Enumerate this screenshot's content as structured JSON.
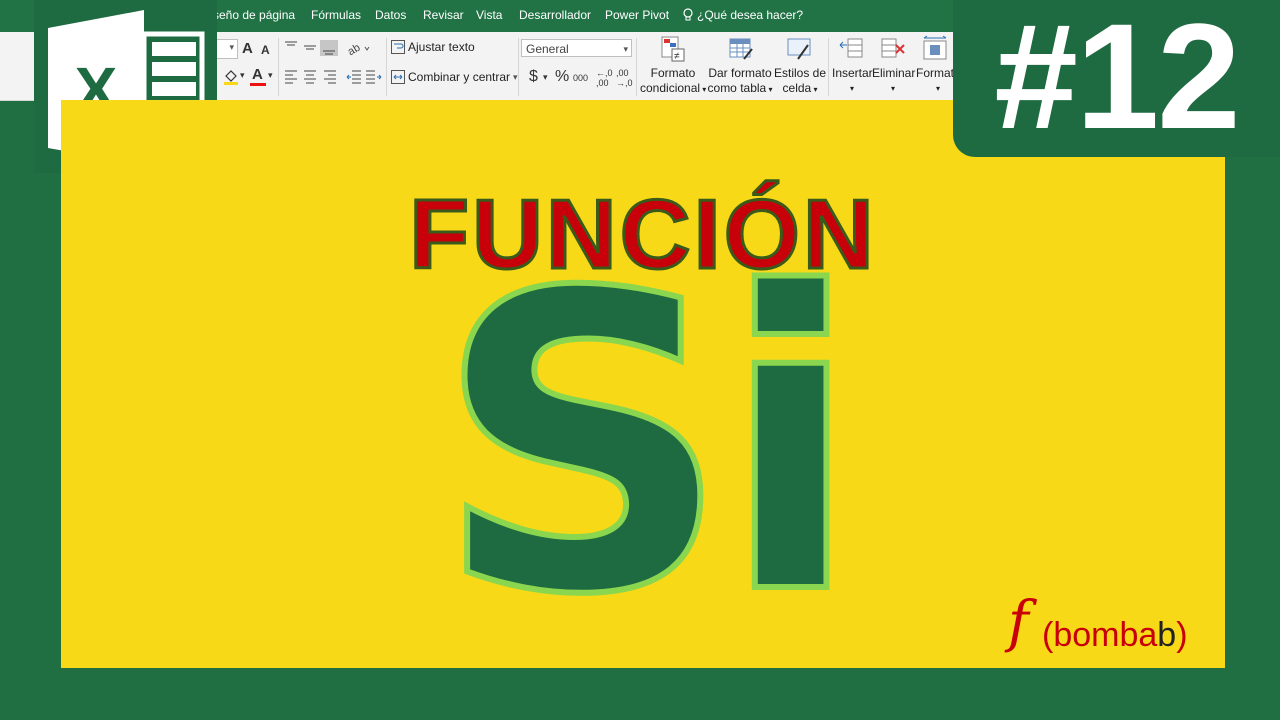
{
  "ribbon": {
    "menus": [
      "seño de página",
      "Fórmulas",
      "Datos",
      "Revisar",
      "Vista",
      "Desarrollador",
      "Power Pivot"
    ],
    "search_label": "¿Qué desea hacer?",
    "wrap_text": "Ajustar texto",
    "merge_center": "Combinar y centrar",
    "number_format": "General",
    "currency_symbol": "$",
    "percent_symbol": "%",
    "thousands_symbol": "000",
    "decimals_add": "←,0 ,00",
    "decimals_remove": ",00 →,0",
    "font_grow": "A",
    "font_shrink": "A",
    "font_color_label": "A",
    "groups": {
      "conditional_format": [
        "Formato",
        "condicional"
      ],
      "table_format": [
        "Dar formato",
        "como tabla"
      ],
      "cell_styles": [
        "Estilos de",
        "celda"
      ],
      "insert": "Insertar",
      "delete": "Eliminar",
      "format": "Formato"
    }
  },
  "logo": {
    "letter": "X"
  },
  "badge": {
    "text": "#12"
  },
  "title": {
    "line1": "FUNCIÓN",
    "line2": "Si"
  },
  "brand": {
    "f": "f",
    "open": "(",
    "part1": "bomba",
    "part2": "b",
    "close": ")"
  },
  "colors": {
    "frame": "#1f6f43",
    "panel": "#f7d917",
    "title_red": "#c8000a",
    "si_fill": "#1f6b41",
    "si_stroke": "#8ad64e",
    "badge": "#1f6b41"
  }
}
